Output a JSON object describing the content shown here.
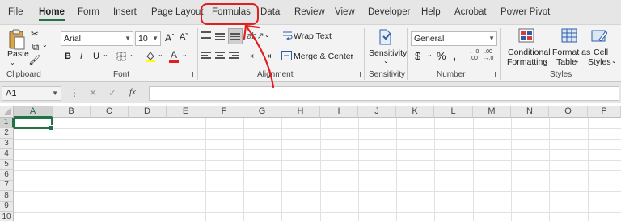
{
  "tabs": [
    "File",
    "Home",
    "Form",
    "Insert",
    "Page Layout",
    "Formulas",
    "Data",
    "Review",
    "View",
    "Developer",
    "Help",
    "Acrobat",
    "Power Pivot"
  ],
  "active_tab": "Home",
  "clipboard": {
    "paste_label": "Paste",
    "group_label": "Clipboard"
  },
  "font": {
    "name": "Arial",
    "size": "10",
    "grow": "Aˆ",
    "shrink": "Aˇ",
    "bold": "B",
    "italic": "I",
    "underline": "U",
    "font_color_letter": "A",
    "group_label": "Font"
  },
  "alignment": {
    "wrap_text": "Wrap Text",
    "merge_center": "Merge & Center",
    "group_label": "Alignment"
  },
  "sensitivity": {
    "label": "Sensitivity",
    "group_label": "Sensitivity"
  },
  "number": {
    "format": "General",
    "currency": "$",
    "percent": "%",
    "comma": "̹",
    "inc_decimal": "←.0\n.00",
    "dec_decimal": ".00\n→.0",
    "group_label": "Number"
  },
  "styles": {
    "conditional": "Conditional",
    "conditional2": "Formatting",
    "format_as": "Format as",
    "format_as2": "Table",
    "cell": "Cell",
    "cell2": "Styles",
    "group_label": "Styles"
  },
  "formula_bar": {
    "name_box": "A1",
    "fx": "fx"
  },
  "columns": [
    "A",
    "B",
    "C",
    "D",
    "E",
    "F",
    "G",
    "H",
    "I",
    "J",
    "K",
    "L",
    "M",
    "N",
    "O",
    "P"
  ],
  "rows": [
    "1",
    "2",
    "3",
    "4",
    "5",
    "6",
    "7",
    "8",
    "9",
    "10"
  ],
  "colors": {
    "accent": "#217346",
    "annotation": "#e02020",
    "font_color_bar": "#e02020",
    "highlight_bar": "#ffff00"
  }
}
